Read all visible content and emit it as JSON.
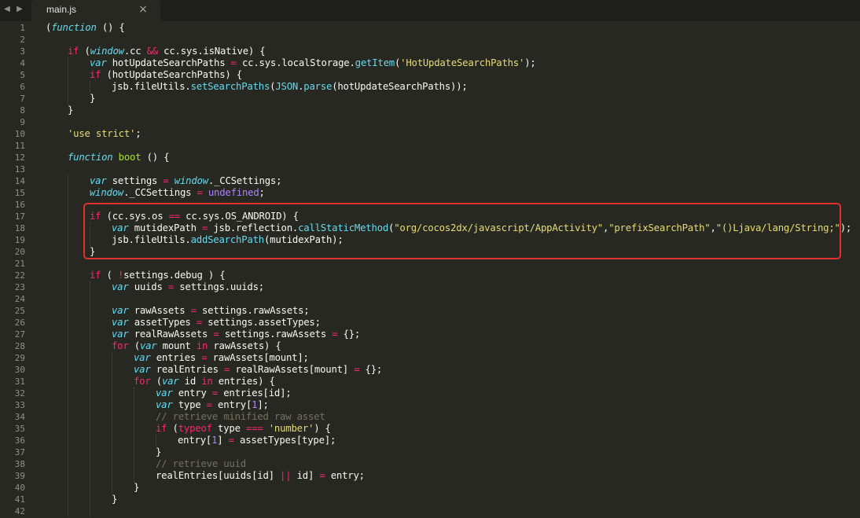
{
  "tab": {
    "filename": "main.js",
    "close_glyph": "×"
  },
  "nav": {
    "back": "◀",
    "forward": "▶"
  },
  "colors": {
    "background": "#272822",
    "keyword": "#f92672",
    "storage": "#66d9ef",
    "function": "#a6e22e",
    "string": "#e6db74",
    "number": "#ae81ff",
    "comment": "#75715e",
    "highlight_box": "#e2302d"
  },
  "code_lines": [
    {
      "n": "1",
      "indent": 0,
      "tokens": [
        [
          "pl",
          "("
        ],
        [
          "st",
          "function"
        ],
        [
          "pl",
          " () {"
        ]
      ]
    },
    {
      "n": "2",
      "indent": 0,
      "tokens": []
    },
    {
      "n": "3",
      "indent": 1,
      "tokens": [
        [
          "kw",
          "if"
        ],
        [
          "pl",
          " ("
        ],
        [
          "st",
          "window"
        ],
        [
          "pl",
          ".cc "
        ],
        [
          "kw",
          "&&"
        ],
        [
          "pl",
          " cc.sys.isNative) {"
        ]
      ]
    },
    {
      "n": "4",
      "indent": 2,
      "tokens": [
        [
          "st",
          "var"
        ],
        [
          "pl",
          " hotUpdateSearchPaths "
        ],
        [
          "kw",
          "="
        ],
        [
          "pl",
          " cc.sys.localStorage."
        ],
        [
          "sup",
          "getItem"
        ],
        [
          "pl",
          "("
        ],
        [
          "str",
          "'HotUpdateSearchPaths'"
        ],
        [
          "pl",
          ");"
        ]
      ]
    },
    {
      "n": "5",
      "indent": 2,
      "tokens": [
        [
          "kw",
          "if"
        ],
        [
          "pl",
          " (hotUpdateSearchPaths) {"
        ]
      ]
    },
    {
      "n": "6",
      "indent": 3,
      "tokens": [
        [
          "pl",
          "jsb.fileUtils."
        ],
        [
          "sup",
          "setSearchPaths"
        ],
        [
          "pl",
          "("
        ],
        [
          "sup",
          "JSON"
        ],
        [
          "pl",
          "."
        ],
        [
          "sup",
          "parse"
        ],
        [
          "pl",
          "(hotUpdateSearchPaths));"
        ]
      ]
    },
    {
      "n": "7",
      "indent": 2,
      "tokens": [
        [
          "pl",
          "}"
        ]
      ]
    },
    {
      "n": "8",
      "indent": 1,
      "tokens": [
        [
          "pl",
          "}"
        ]
      ]
    },
    {
      "n": "9",
      "indent": 0,
      "tokens": []
    },
    {
      "n": "10",
      "indent": 1,
      "tokens": [
        [
          "str",
          "'use strict'"
        ],
        [
          "pl",
          ";"
        ]
      ]
    },
    {
      "n": "11",
      "indent": 0,
      "tokens": []
    },
    {
      "n": "12",
      "indent": 1,
      "tokens": [
        [
          "st",
          "function"
        ],
        [
          "pl",
          " "
        ],
        [
          "fn",
          "boot"
        ],
        [
          "pl",
          " () {"
        ]
      ]
    },
    {
      "n": "13",
      "indent": 0,
      "tokens": []
    },
    {
      "n": "14",
      "indent": 2,
      "tokens": [
        [
          "st",
          "var"
        ],
        [
          "pl",
          " settings "
        ],
        [
          "kw",
          "="
        ],
        [
          "pl",
          " "
        ],
        [
          "st",
          "window"
        ],
        [
          "pl",
          "._CCSettings;"
        ]
      ]
    },
    {
      "n": "15",
      "indent": 2,
      "tokens": [
        [
          "st",
          "window"
        ],
        [
          "pl",
          "._CCSettings "
        ],
        [
          "kw",
          "="
        ],
        [
          "pl",
          " "
        ],
        [
          "num",
          "undefined"
        ],
        [
          "pl",
          ";"
        ]
      ]
    },
    {
      "n": "16",
      "indent": 0,
      "tokens": []
    },
    {
      "n": "17",
      "indent": 2,
      "tokens": [
        [
          "kw",
          "if"
        ],
        [
          "pl",
          " (cc.sys.os "
        ],
        [
          "kw",
          "=="
        ],
        [
          "pl",
          " cc.sys.OS_ANDROID) {"
        ]
      ]
    },
    {
      "n": "18",
      "indent": 3,
      "tokens": [
        [
          "st",
          "var"
        ],
        [
          "pl",
          " mutidexPath "
        ],
        [
          "kw",
          "="
        ],
        [
          "pl",
          " jsb.reflection."
        ],
        [
          "sup",
          "callStaticMethod"
        ],
        [
          "pl",
          "("
        ],
        [
          "str",
          "\"org/cocos2dx/javascript/AppActivity\""
        ],
        [
          "pl",
          ","
        ],
        [
          "str",
          "\"prefixSearchPath\""
        ],
        [
          "pl",
          ","
        ],
        [
          "str",
          "\"()Ljava/lang/String;\""
        ],
        [
          "pl",
          ");"
        ]
      ]
    },
    {
      "n": "19",
      "indent": 3,
      "tokens": [
        [
          "pl",
          "jsb.fileUtils."
        ],
        [
          "sup",
          "addSearchPath"
        ],
        [
          "pl",
          "(mutidexPath);"
        ]
      ]
    },
    {
      "n": "20",
      "indent": 2,
      "tokens": [
        [
          "pl",
          "}"
        ]
      ]
    },
    {
      "n": "21",
      "indent": 0,
      "tokens": []
    },
    {
      "n": "22",
      "indent": 2,
      "tokens": [
        [
          "kw",
          "if"
        ],
        [
          "pl",
          " ( "
        ],
        [
          "kw",
          "!"
        ],
        [
          "pl",
          "settings.debug ) {"
        ]
      ]
    },
    {
      "n": "23",
      "indent": 3,
      "tokens": [
        [
          "st",
          "var"
        ],
        [
          "pl",
          " uuids "
        ],
        [
          "kw",
          "="
        ],
        [
          "pl",
          " settings.uuids;"
        ]
      ]
    },
    {
      "n": "24",
      "indent": 0,
      "tokens": []
    },
    {
      "n": "25",
      "indent": 3,
      "tokens": [
        [
          "st",
          "var"
        ],
        [
          "pl",
          " rawAssets "
        ],
        [
          "kw",
          "="
        ],
        [
          "pl",
          " settings.rawAssets;"
        ]
      ]
    },
    {
      "n": "26",
      "indent": 3,
      "tokens": [
        [
          "st",
          "var"
        ],
        [
          "pl",
          " assetTypes "
        ],
        [
          "kw",
          "="
        ],
        [
          "pl",
          " settings.assetTypes;"
        ]
      ]
    },
    {
      "n": "27",
      "indent": 3,
      "tokens": [
        [
          "st",
          "var"
        ],
        [
          "pl",
          " realRawAssets "
        ],
        [
          "kw",
          "="
        ],
        [
          "pl",
          " settings.rawAssets "
        ],
        [
          "kw",
          "="
        ],
        [
          "pl",
          " {};"
        ]
      ]
    },
    {
      "n": "28",
      "indent": 3,
      "tokens": [
        [
          "kw",
          "for"
        ],
        [
          "pl",
          " ("
        ],
        [
          "st",
          "var"
        ],
        [
          "pl",
          " mount "
        ],
        [
          "kw",
          "in"
        ],
        [
          "pl",
          " rawAssets) {"
        ]
      ]
    },
    {
      "n": "29",
      "indent": 4,
      "tokens": [
        [
          "st",
          "var"
        ],
        [
          "pl",
          " entries "
        ],
        [
          "kw",
          "="
        ],
        [
          "pl",
          " rawAssets[mount];"
        ]
      ]
    },
    {
      "n": "30",
      "indent": 4,
      "tokens": [
        [
          "st",
          "var"
        ],
        [
          "pl",
          " realEntries "
        ],
        [
          "kw",
          "="
        ],
        [
          "pl",
          " realRawAssets[mount] "
        ],
        [
          "kw",
          "="
        ],
        [
          "pl",
          " {};"
        ]
      ]
    },
    {
      "n": "31",
      "indent": 4,
      "tokens": [
        [
          "kw",
          "for"
        ],
        [
          "pl",
          " ("
        ],
        [
          "st",
          "var"
        ],
        [
          "pl",
          " id "
        ],
        [
          "kw",
          "in"
        ],
        [
          "pl",
          " entries) {"
        ]
      ]
    },
    {
      "n": "32",
      "indent": 5,
      "tokens": [
        [
          "st",
          "var"
        ],
        [
          "pl",
          " entry "
        ],
        [
          "kw",
          "="
        ],
        [
          "pl",
          " entries[id];"
        ]
      ]
    },
    {
      "n": "33",
      "indent": 5,
      "tokens": [
        [
          "st",
          "var"
        ],
        [
          "pl",
          " type "
        ],
        [
          "kw",
          "="
        ],
        [
          "pl",
          " entry["
        ],
        [
          "num",
          "1"
        ],
        [
          "pl",
          "];"
        ]
      ]
    },
    {
      "n": "34",
      "indent": 5,
      "tokens": [
        [
          "cm",
          "// retrieve minified raw asset"
        ]
      ]
    },
    {
      "n": "35",
      "indent": 5,
      "tokens": [
        [
          "kw",
          "if"
        ],
        [
          "pl",
          " ("
        ],
        [
          "kw",
          "typeof"
        ],
        [
          "pl",
          " type "
        ],
        [
          "kw",
          "==="
        ],
        [
          "pl",
          " "
        ],
        [
          "str",
          "'number'"
        ],
        [
          "pl",
          ") {"
        ]
      ]
    },
    {
      "n": "36",
      "indent": 6,
      "tokens": [
        [
          "pl",
          "entry["
        ],
        [
          "num",
          "1"
        ],
        [
          "pl",
          "] "
        ],
        [
          "kw",
          "="
        ],
        [
          "pl",
          " assetTypes[type];"
        ]
      ]
    },
    {
      "n": "37",
      "indent": 5,
      "tokens": [
        [
          "pl",
          "}"
        ]
      ]
    },
    {
      "n": "38",
      "indent": 5,
      "tokens": [
        [
          "cm",
          "// retrieve uuid"
        ]
      ]
    },
    {
      "n": "39",
      "indent": 5,
      "tokens": [
        [
          "pl",
          "realEntries[uuids[id] "
        ],
        [
          "kw",
          "||"
        ],
        [
          "pl",
          " id] "
        ],
        [
          "kw",
          "="
        ],
        [
          "pl",
          " entry;"
        ]
      ]
    },
    {
      "n": "40",
      "indent": 4,
      "tokens": [
        [
          "pl",
          "}"
        ]
      ]
    },
    {
      "n": "41",
      "indent": 3,
      "tokens": [
        [
          "pl",
          "}"
        ]
      ]
    },
    {
      "n": "42",
      "indent": 0,
      "tokens": []
    }
  ]
}
